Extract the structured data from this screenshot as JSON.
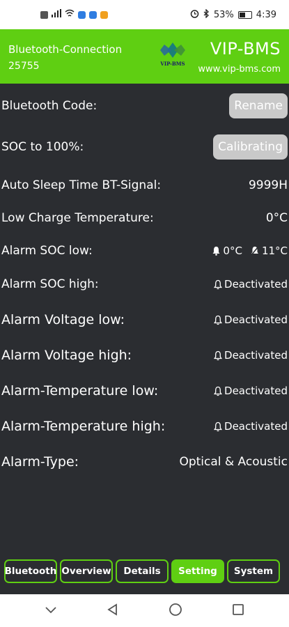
{
  "status_bar": {
    "battery": "53%",
    "time": "4:39"
  },
  "header": {
    "connection": "Bluetooth-Connection",
    "device_id": "25755",
    "logo_text": "VIP-BMS",
    "brand": "VIP-BMS",
    "url": "www.vip-bms.com"
  },
  "settings": {
    "bt_code": {
      "label": "Bluetooth Code:",
      "button": "Rename"
    },
    "soc100": {
      "label": "SOC to 100%:",
      "button": "Calibrating"
    },
    "sleep": {
      "label": "Auto Sleep Time BT-Signal:",
      "value": "9999H"
    },
    "low_charge_temp": {
      "label": "Low Charge Temperature:",
      "value": "0°C"
    },
    "alarm_soc_low": {
      "label": "Alarm SOC low:",
      "value1": "0°C",
      "value2": "11°C"
    },
    "alarm_soc_high": {
      "label": "Alarm SOC high:",
      "value": "Deactivated"
    },
    "alarm_voltage_low": {
      "label": "Alarm Voltage low:",
      "value": "Deactivated"
    },
    "alarm_voltage_high": {
      "label": "Alarm Voltage high:",
      "value": "Deactivated"
    },
    "alarm_temp_low": {
      "label": "Alarm-Temperature low:",
      "value": "Deactivated"
    },
    "alarm_temp_high": {
      "label": "Alarm-Temperature high:",
      "value": "Deactivated"
    },
    "alarm_type": {
      "label": "Alarm-Type:",
      "value": "Optical & Acoustic"
    }
  },
  "tabs": [
    "Bluetooth",
    "Overview",
    "Details",
    "Setting",
    "System"
  ],
  "active_tab": "Setting",
  "colors": {
    "accent": "#5fcf12",
    "background": "#2b2d31",
    "button_gray": "#c9c9c9"
  }
}
